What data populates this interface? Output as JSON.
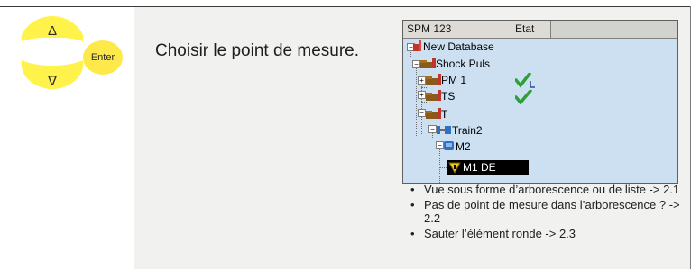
{
  "keypad": {
    "up_glyph": "Δ",
    "enter_label": "Enter",
    "down_glyph": "∇",
    "key_color": "#fff24a",
    "enter_color": "#fde94a"
  },
  "instruction": "Choisir le point de mesure.",
  "tree": {
    "columns": [
      "SPM 123",
      "Etat"
    ],
    "nodes": [
      {
        "label": "New Database",
        "icon": "database-icon"
      },
      {
        "label": "Shock Puls",
        "icon": "folder-icon"
      },
      {
        "label": "PM 1",
        "icon": "folder-icon",
        "status": "check-l-icon"
      },
      {
        "label": "TS",
        "icon": "folder-icon",
        "status": "check-icon"
      },
      {
        "label": "T",
        "icon": "folder-icon"
      },
      {
        "label": "Train2",
        "icon": "machine-icon"
      },
      {
        "label": "M2",
        "icon": "machine-icon"
      },
      {
        "label": "M1 DE",
        "icon": "warning-icon",
        "selected": true
      }
    ],
    "panel_color": "#cde0f1",
    "check_color": "#2f9f3c"
  },
  "notes": {
    "bullet": "•",
    "items": [
      "Vue sous forme d’arborescence ou de liste -> 2.1",
      "Pas de point de mesure dans l’arborescence ? -> 2.2",
      "Sauter l’élément ronde -> 2.3"
    ]
  }
}
